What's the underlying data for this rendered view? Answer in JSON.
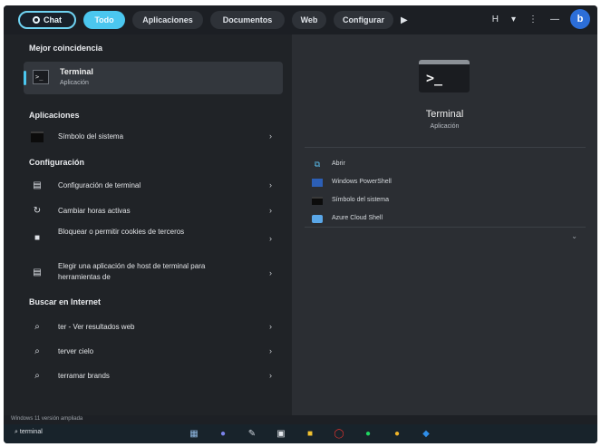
{
  "topbar": {
    "chat": "Chat",
    "tabs": [
      "Todo",
      "Aplicaciones",
      "Documentos",
      "Web",
      "Configurar"
    ],
    "play_icon": "play-icon",
    "right": {
      "text": "H",
      "network_icon": "wifi-icon",
      "more": "⋮",
      "minimize": "—",
      "bing": "b"
    }
  },
  "left": {
    "best_match_title": "Mejor coincidencia",
    "best_match": {
      "name": "Terminal",
      "type": "Aplicación"
    },
    "apps_title": "Aplicaciones",
    "apps": [
      {
        "label": "Símbolo del sistema"
      }
    ],
    "settings_title": "Configuración",
    "settings": [
      {
        "label": "Configuración de terminal"
      },
      {
        "label": "Cambiar horas activas"
      },
      {
        "label": "Bloquear o permitir cookies de terceros"
      },
      {
        "label": "Elegir una aplicación de host de terminal para herramientas de"
      }
    ],
    "web_title": "Buscar en Internet",
    "web": [
      {
        "label": "ter - Ver resultados web"
      },
      {
        "label": "terver cielo"
      },
      {
        "label": "terramar brands"
      }
    ],
    "chevron": "›"
  },
  "right": {
    "app_name": "Terminal",
    "app_type": "Aplicación",
    "prompt": ">_",
    "actions": [
      {
        "label": "Abrir",
        "icon": "open-icon"
      },
      {
        "label": "Windows PowerShell",
        "icon": "powershell-icon"
      },
      {
        "label": "Símbolo del sistema",
        "icon": "command-prompt-icon"
      },
      {
        "label": "Azure Cloud Shell",
        "icon": "azure-cloud-shell-icon"
      }
    ],
    "expand": "⌄"
  },
  "status": {
    "left": "Windows 11 versión ampliada",
    "right": ""
  },
  "taskbar": {
    "search": "terminal",
    "apps": [
      {
        "icon": "widgets-icon",
        "glyph": "▦",
        "color": "#8fb7e0"
      },
      {
        "icon": "teams-icon",
        "glyph": "●",
        "color": "#7b83eb"
      },
      {
        "icon": "edit-icon",
        "glyph": "✎",
        "color": "#cfd6de"
      },
      {
        "icon": "store-icon",
        "glyph": "▣",
        "color": "#e5e9ee"
      },
      {
        "icon": "file-explorer-icon",
        "glyph": "■",
        "color": "#f2c230"
      },
      {
        "icon": "opera-icon",
        "glyph": "◯",
        "color": "#e6342f"
      },
      {
        "icon": "spotify-icon",
        "glyph": "●",
        "color": "#1ed760"
      },
      {
        "icon": "chrome-icon",
        "glyph": "●",
        "color": "#f0b429"
      },
      {
        "icon": "vscode-icon",
        "glyph": "◆",
        "color": "#2f8ee8"
      }
    ]
  }
}
